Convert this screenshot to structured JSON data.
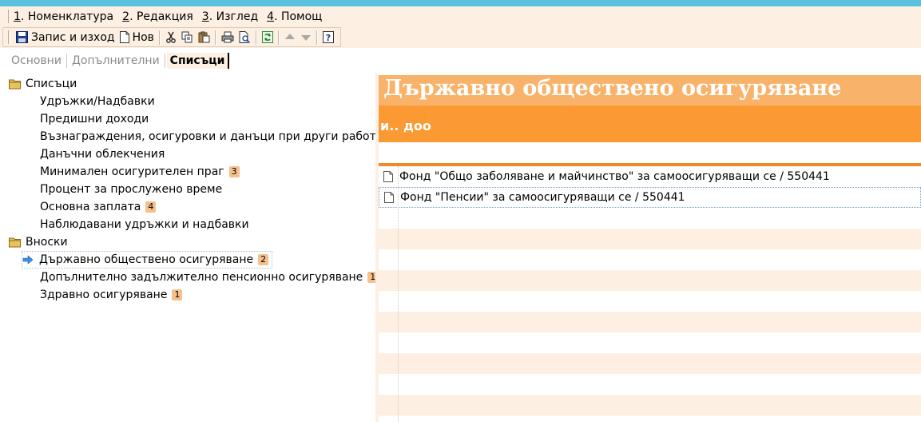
{
  "menu": {
    "items": [
      {
        "key": "1",
        "label": ". Номенклатура"
      },
      {
        "key": "2",
        "label": ". Редакция"
      },
      {
        "key": "3",
        "label": ". Изглед"
      },
      {
        "key": "4",
        "label": ". Помощ"
      }
    ]
  },
  "toolbar": {
    "save_exit_label": "Запис и изход",
    "new_label": "Нов"
  },
  "tabs": [
    {
      "label": "Основни"
    },
    {
      "label": "Допълнителни"
    },
    {
      "label": "Списъци"
    }
  ],
  "tree": {
    "groups": [
      {
        "label": "Списъци",
        "items": [
          {
            "label": "Удръжки/Надбавки",
            "badge": ""
          },
          {
            "label": "Предишни доходи",
            "badge": ""
          },
          {
            "label": "Възнаграждения, осигуровки и данъци при други работодатели",
            "badge": ""
          },
          {
            "label": "Данъчни облекчения",
            "badge": ""
          },
          {
            "label": "Минимален осигурителен праг",
            "badge": "3"
          },
          {
            "label": "Процент за прослужено време",
            "badge": ""
          },
          {
            "label": "Основна заплата",
            "badge": "4"
          },
          {
            "label": "Наблюдавани удръжки и надбавки",
            "badge": ""
          }
        ]
      },
      {
        "label": "Вноски",
        "items": [
          {
            "label": "Държавно обществено осигуряване",
            "badge": "2"
          },
          {
            "label": "Допълнително задължително пенсионно осигуряване",
            "badge": "1"
          },
          {
            "label": "Здравно осигуряване",
            "badge": "1"
          }
        ]
      }
    ]
  },
  "detail": {
    "title": "Държавно обществено осигуряване",
    "subtitle": "и.. доо",
    "rows": [
      {
        "label": "Фонд \"Общо заболяване и майчинство\" за самоосигуряващи се / 550441"
      },
      {
        "label": "Фонд \"Пенсии\" за самоосигуряващи се / 550441"
      }
    ]
  },
  "colors": {
    "menu_bg": "#fdf0e2",
    "title_band": "#f9b26a",
    "subtitle_band": "#fb9a33",
    "badge": "#f5c08c",
    "top_strip": "#5bc0de"
  }
}
